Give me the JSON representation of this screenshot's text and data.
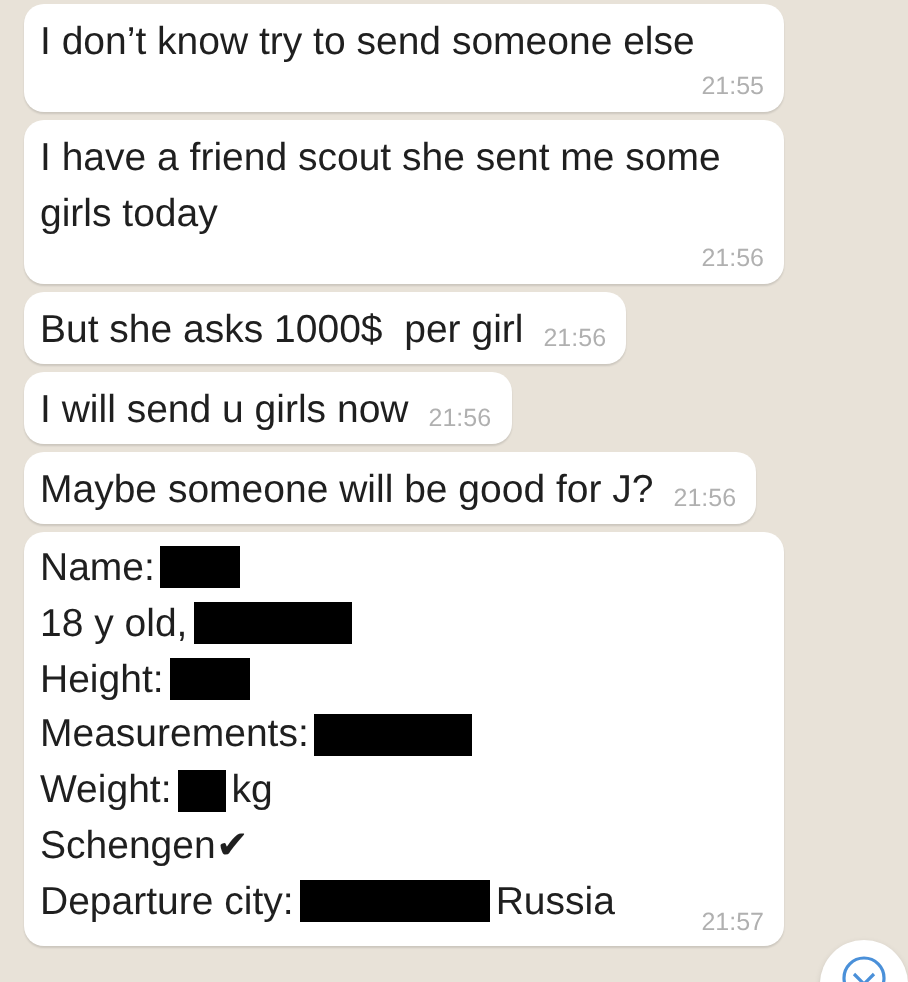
{
  "messages": [
    {
      "kind": "text",
      "text": "I don’t know try to send someone else",
      "time": "21:55"
    },
    {
      "kind": "text",
      "text": "I have a friend scout she sent me some girls today",
      "time": "21:56"
    },
    {
      "kind": "text",
      "text": "But she asks 1000$  per girl",
      "time": "21:56"
    },
    {
      "kind": "text",
      "text": "I will send u girls now",
      "time": "21:56"
    },
    {
      "kind": "text",
      "text": "Maybe someone will be good for J?",
      "time": "21:56"
    },
    {
      "kind": "form",
      "time": "21:57",
      "lines": [
        [
          {
            "kind": "text",
            "text": "Name:"
          },
          {
            "kind": "redaction_short"
          }
        ],
        [
          {
            "kind": "text",
            "text": "18 y old,"
          },
          {
            "kind": "redaction_long"
          }
        ],
        [
          {
            "kind": "text",
            "text": "Height:"
          },
          {
            "kind": "redaction_short"
          }
        ],
        [
          {
            "kind": "text",
            "text": "Measurements:"
          },
          {
            "kind": "redaction_long"
          }
        ],
        [
          {
            "kind": "text",
            "text": "Weight:"
          },
          {
            "kind": "redaction_tiny"
          },
          {
            "kind": "text",
            "text": "kg"
          }
        ],
        [
          {
            "kind": "text",
            "text": "Schengen"
          },
          {
            "kind": "text",
            "text": "✔"
          }
        ],
        [
          {
            "kind": "text",
            "text": "Departure city:"
          },
          {
            "kind": "redaction_wide"
          },
          {
            "kind": "text",
            "text": "Russia"
          }
        ]
      ]
    }
  ]
}
